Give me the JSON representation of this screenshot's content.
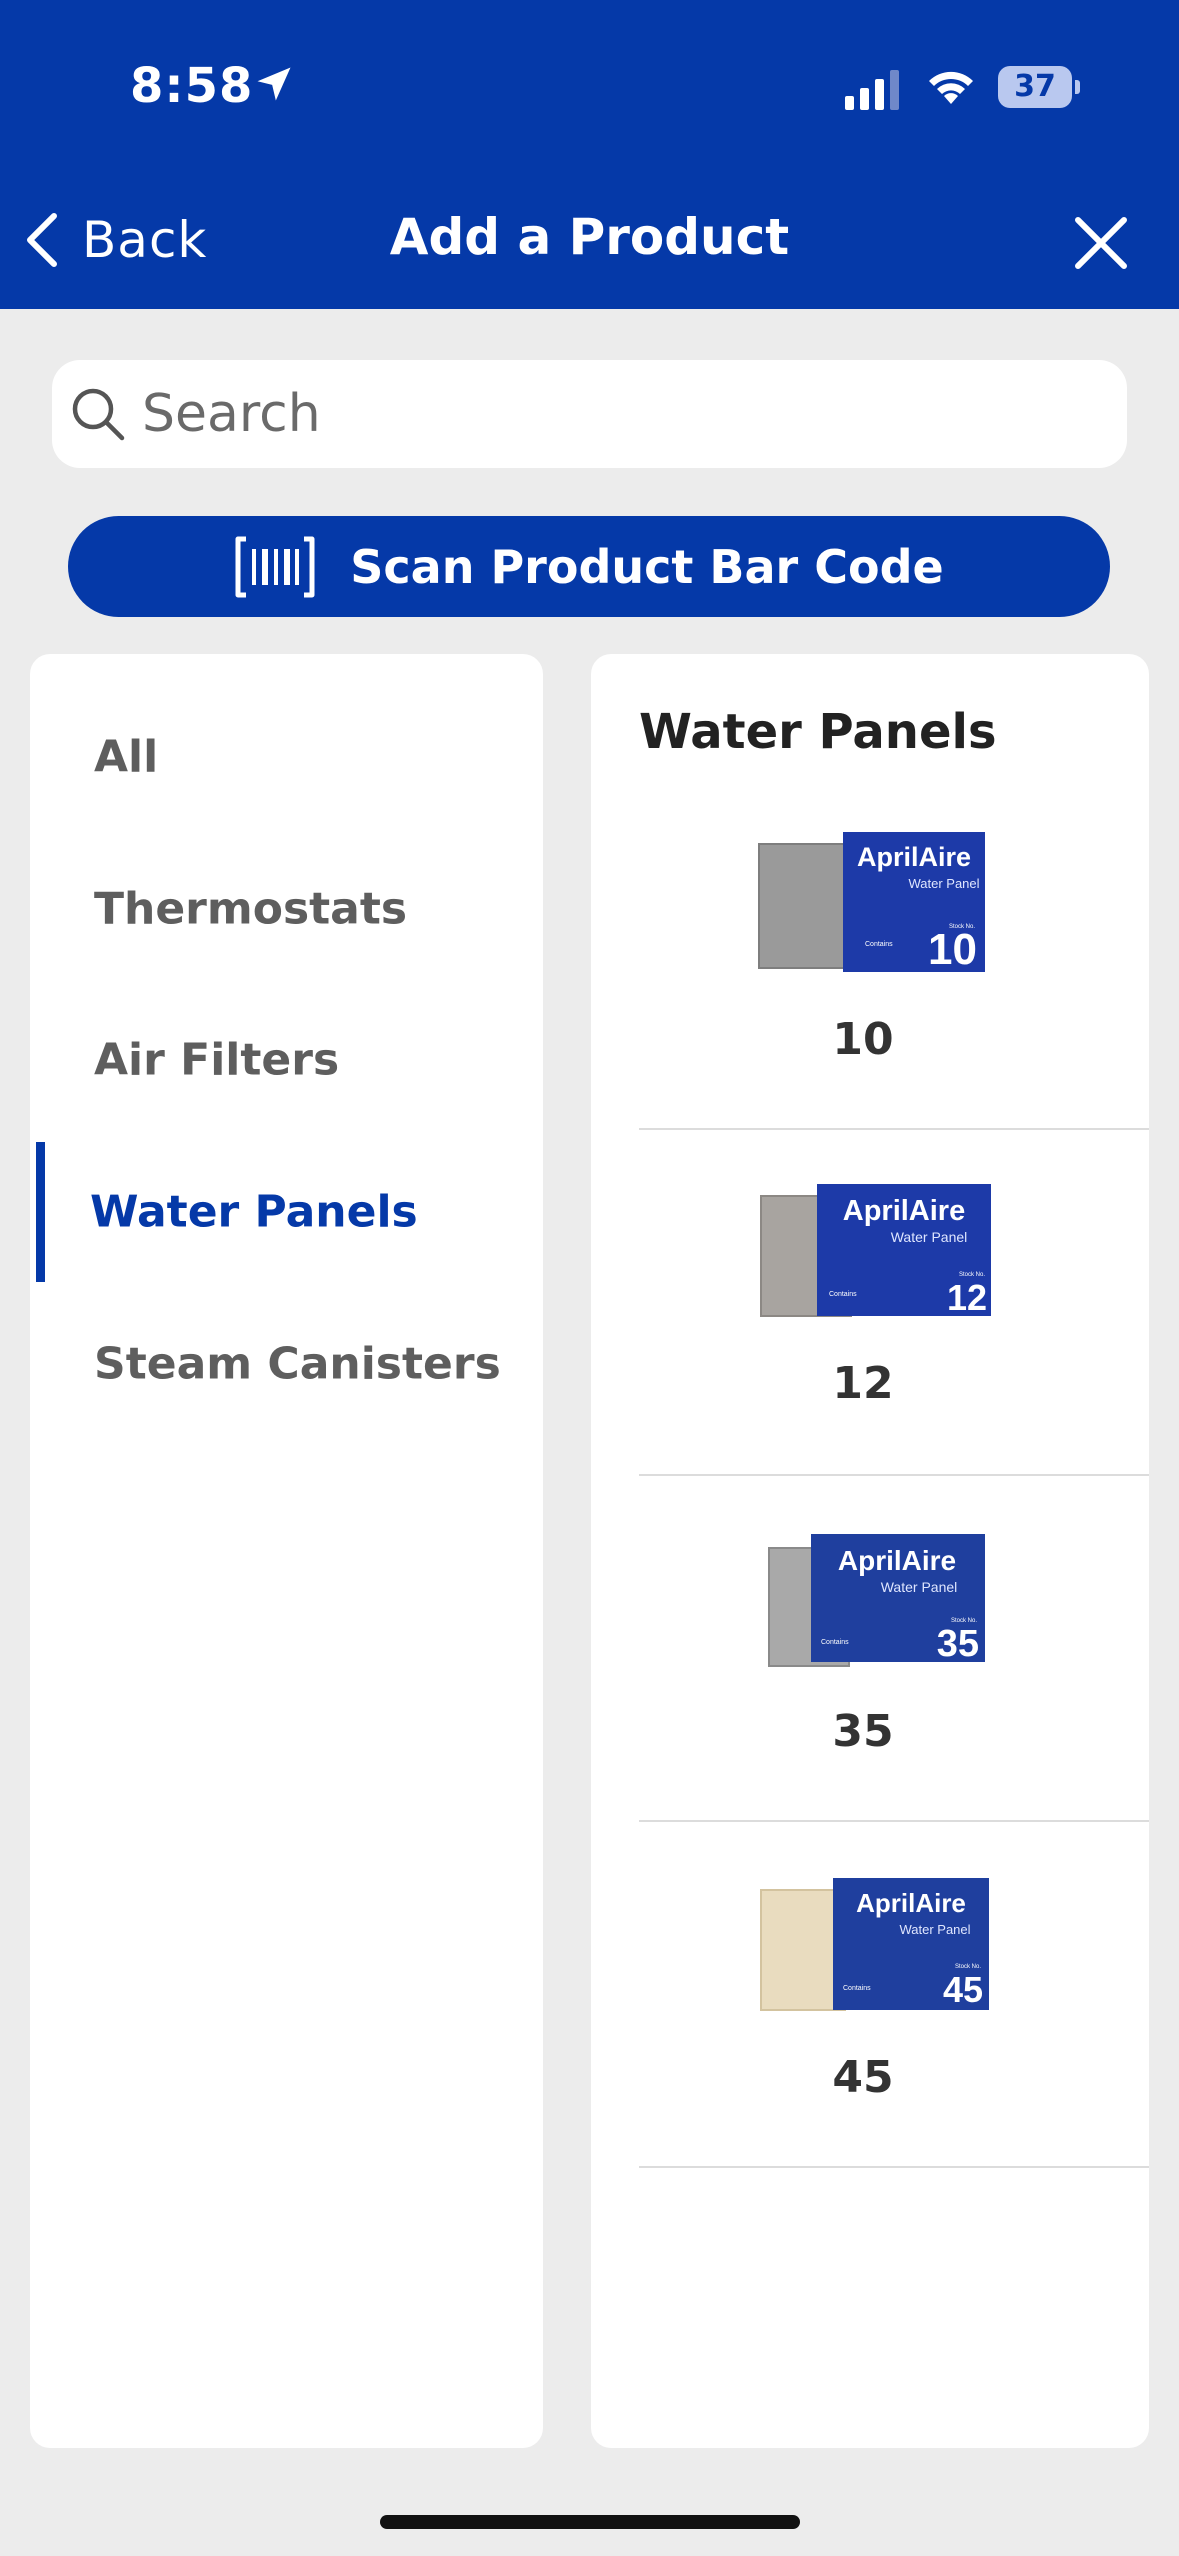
{
  "status_bar": {
    "time": "8:58",
    "battery_level": "37",
    "battery_fraction": 0.37
  },
  "nav": {
    "back_label": "Back",
    "title": "Add a Product"
  },
  "search": {
    "placeholder": "Search",
    "value": ""
  },
  "scan_button": {
    "label": "Scan Product Bar Code"
  },
  "categories": [
    {
      "label": "All",
      "active": false
    },
    {
      "label": "Thermostats",
      "active": false
    },
    {
      "label": "Air Filters",
      "active": false
    },
    {
      "label": "Water Panels",
      "active": true
    },
    {
      "label": "Steam Canisters",
      "active": false
    }
  ],
  "products_panel": {
    "heading": "Water Panels",
    "brand": "AprilAire",
    "box_subtitle": "Water Panel",
    "stock_label": "Stock No.",
    "contains_label": "Contains",
    "items": [
      {
        "label": "10",
        "pad_color": "#9a9a9a"
      },
      {
        "label": "12",
        "pad_color": "#a8a4a0"
      },
      {
        "label": "35",
        "pad_color": "#a9a9a9"
      },
      {
        "label": "45",
        "pad_color": "#e9dcbf"
      }
    ]
  },
  "colors": {
    "brand_blue": "#0539a8",
    "background": "#ececec"
  }
}
